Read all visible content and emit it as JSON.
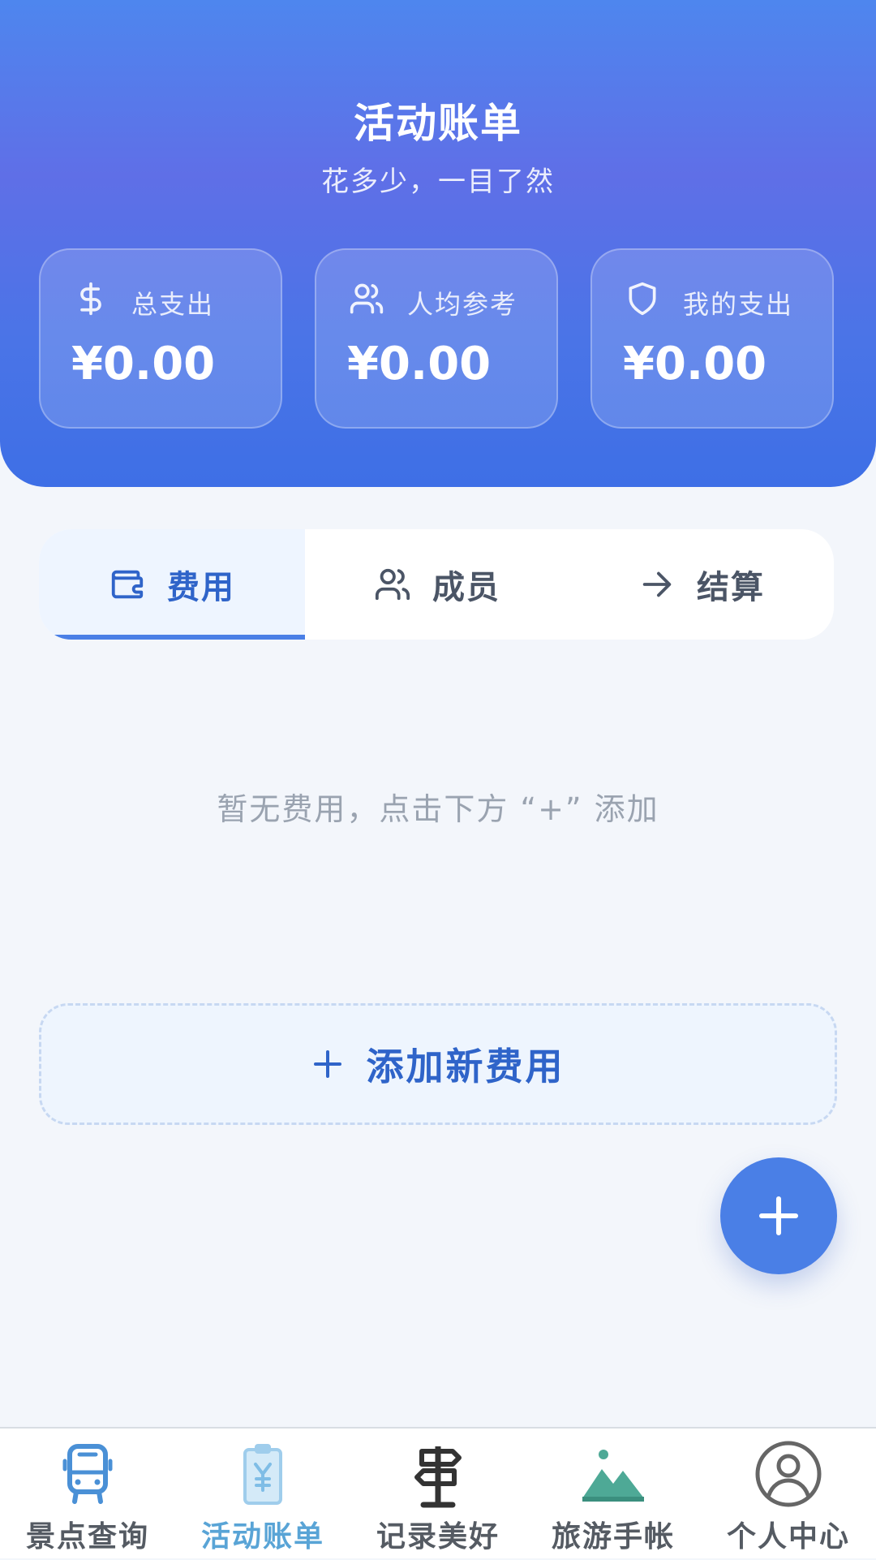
{
  "header": {
    "title": "活动账单",
    "subtitle": "花多少，一目了然",
    "stats": [
      {
        "label": "总支出",
        "value": "¥0.00",
        "icon": "dollar-icon"
      },
      {
        "label": "人均参考",
        "value": "¥0.00",
        "icon": "users-icon"
      },
      {
        "label": "我的支出",
        "value": "¥0.00",
        "icon": "shield-icon"
      }
    ]
  },
  "tabs": [
    {
      "label": "费用",
      "icon": "wallet-icon",
      "active": true
    },
    {
      "label": "成员",
      "icon": "users-icon",
      "active": false
    },
    {
      "label": "结算",
      "icon": "arrow-right-icon",
      "active": false
    }
  ],
  "main": {
    "empty_text": "暂无费用，点击下方 “+” 添加",
    "add_button_label": "添加新费用"
  },
  "bottom_nav": [
    {
      "label": "景点查询",
      "icon": "bus-icon",
      "active": false
    },
    {
      "label": "活动账单",
      "icon": "clipboard-yen-icon",
      "active": true
    },
    {
      "label": "记录美好",
      "icon": "signpost-icon",
      "active": false
    },
    {
      "label": "旅游手帐",
      "icon": "mountain-icon",
      "active": false
    },
    {
      "label": "个人中心",
      "icon": "user-circle-icon",
      "active": false
    }
  ],
  "colors": {
    "primary": "#4a7fe6",
    "active_tab_text": "#2f64c9",
    "nav_active": "#59a4d6"
  }
}
